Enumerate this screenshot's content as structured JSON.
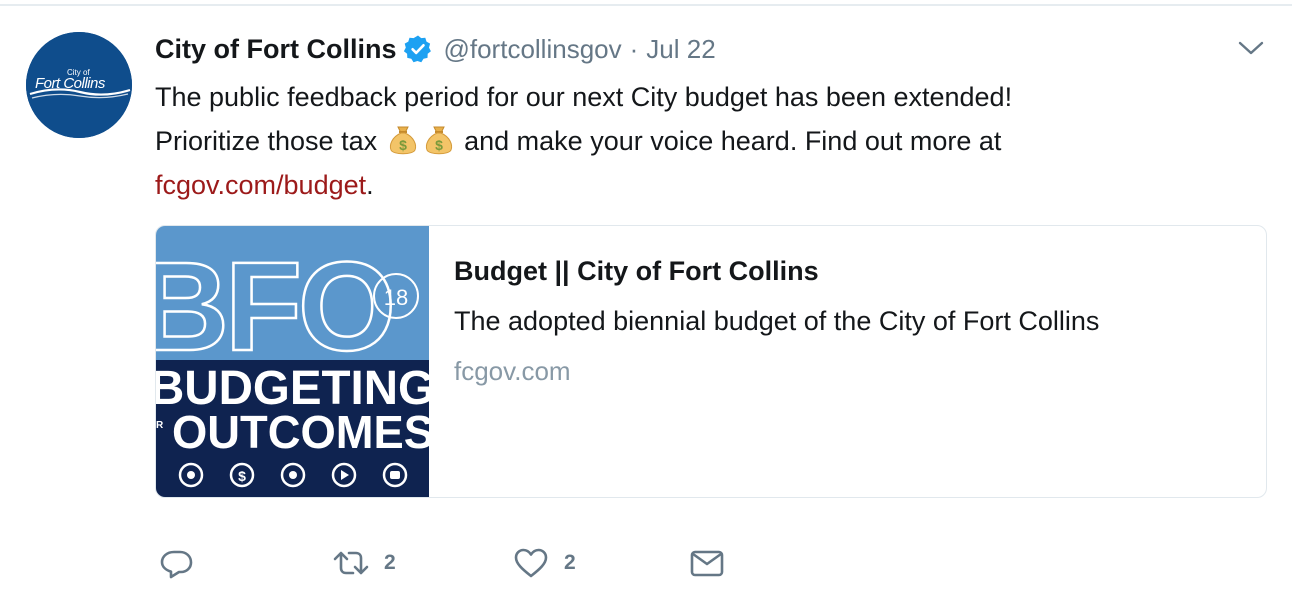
{
  "tweet": {
    "display_name": "City of Fort Collins",
    "handle": "@fortcollinsgov",
    "separator": "·",
    "date": "Jul 22",
    "avatar_text_top": "City of",
    "avatar_text_main": "Fort Collins",
    "text_line1": "The public feedback period for our next City budget has been extended!",
    "text_line2_before": "Prioritize those tax",
    "text_line2_after": "and make your voice heard. Find out more at",
    "link_text": "fcgov.com/budget",
    "link_trailing": ".",
    "emoji": [
      "money-bag-icon",
      "money-bag-icon"
    ]
  },
  "card": {
    "title": "Budget || City of Fort Collins",
    "description": "The adopted biennial budget of the City of Fort Collins",
    "domain": "fcgov.com",
    "image": {
      "big_letters": "BFO",
      "badge": "18",
      "line1": "BUDGETING",
      "line2": "OUTCOMES",
      "small_letters": "R",
      "colors": {
        "top": "#5b97cc",
        "bottom": "#0f2350"
      }
    }
  },
  "actions": {
    "reply": {
      "icon": "reply-icon"
    },
    "retweet": {
      "icon": "retweet-icon",
      "count": "2"
    },
    "like": {
      "icon": "heart-icon",
      "count": "2"
    },
    "dm": {
      "icon": "envelope-icon"
    }
  },
  "colors": {
    "text": "#14171a",
    "muted": "#657786",
    "link": "#9c1a1a",
    "verified": "#1da1f2",
    "avatar_bg": "#0f4d8c"
  }
}
